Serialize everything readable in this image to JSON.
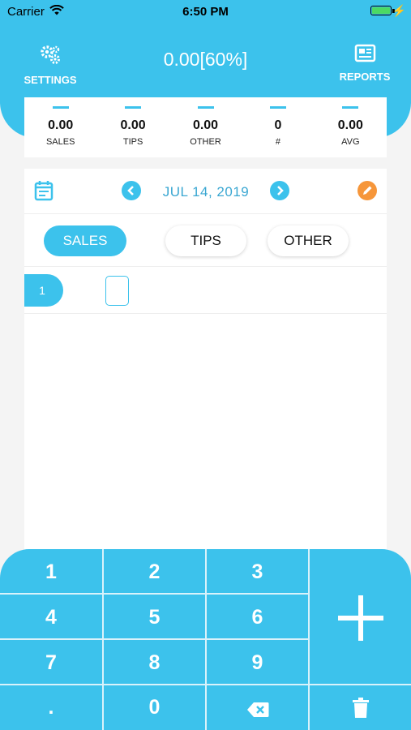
{
  "status_bar": {
    "carrier": "Carrier",
    "time": "6:50 PM"
  },
  "header": {
    "title": "0.00[60%]",
    "settings_label": "SETTINGS",
    "reports_label": "REPORTS",
    "background_color": "#3cc2ec"
  },
  "stats": [
    {
      "value": "0.00",
      "label": "SALES"
    },
    {
      "value": "0.00",
      "label": "TIPS"
    },
    {
      "value": "0.00",
      "label": "OTHER"
    },
    {
      "value": "0",
      "label": "#"
    },
    {
      "value": "0.00",
      "label": "AVG"
    }
  ],
  "date_nav": {
    "date": "JUL 14, 2019",
    "edit_color": "#f6963a"
  },
  "tabs": [
    {
      "label": "SALES",
      "active": true
    },
    {
      "label": "TIPS",
      "active": false
    },
    {
      "label": "OTHER",
      "active": false
    }
  ],
  "entries": [
    {
      "index": "1",
      "value": ""
    }
  ],
  "keypad": {
    "keys": [
      "1",
      "2",
      "3",
      "4",
      "5",
      "6",
      "7",
      "8",
      "9",
      ".",
      "0"
    ],
    "icons": [
      "backspace-icon",
      "plus-icon",
      "trash-icon"
    ]
  }
}
